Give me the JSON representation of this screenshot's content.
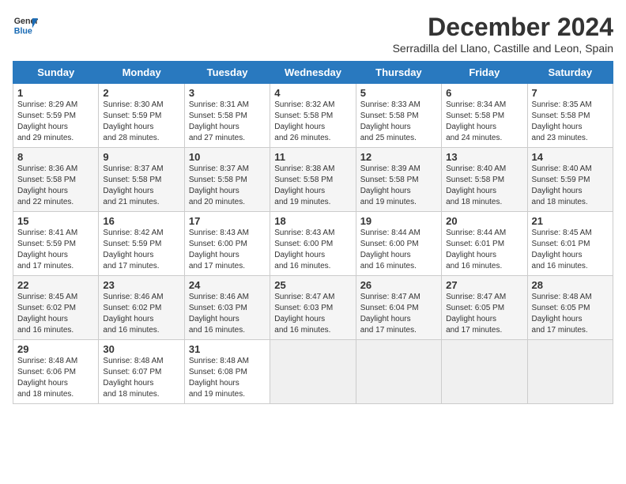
{
  "header": {
    "logo_line1": "General",
    "logo_line2": "Blue",
    "month_title": "December 2024",
    "subtitle": "Serradilla del Llano, Castille and Leon, Spain"
  },
  "weekdays": [
    "Sunday",
    "Monday",
    "Tuesday",
    "Wednesday",
    "Thursday",
    "Friday",
    "Saturday"
  ],
  "weeks": [
    [
      {
        "day": "1",
        "rise": "8:29 AM",
        "set": "5:59 PM",
        "daylight": "9 hours and 29 minutes."
      },
      {
        "day": "2",
        "rise": "8:30 AM",
        "set": "5:59 PM",
        "daylight": "9 hours and 28 minutes."
      },
      {
        "day": "3",
        "rise": "8:31 AM",
        "set": "5:58 PM",
        "daylight": "9 hours and 27 minutes."
      },
      {
        "day": "4",
        "rise": "8:32 AM",
        "set": "5:58 PM",
        "daylight": "9 hours and 26 minutes."
      },
      {
        "day": "5",
        "rise": "8:33 AM",
        "set": "5:58 PM",
        "daylight": "9 hours and 25 minutes."
      },
      {
        "day": "6",
        "rise": "8:34 AM",
        "set": "5:58 PM",
        "daylight": "9 hours and 24 minutes."
      },
      {
        "day": "7",
        "rise": "8:35 AM",
        "set": "5:58 PM",
        "daylight": "9 hours and 23 minutes."
      }
    ],
    [
      {
        "day": "8",
        "rise": "8:36 AM",
        "set": "5:58 PM",
        "daylight": "9 hours and 22 minutes."
      },
      {
        "day": "9",
        "rise": "8:37 AM",
        "set": "5:58 PM",
        "daylight": "9 hours and 21 minutes."
      },
      {
        "day": "10",
        "rise": "8:37 AM",
        "set": "5:58 PM",
        "daylight": "9 hours and 20 minutes."
      },
      {
        "day": "11",
        "rise": "8:38 AM",
        "set": "5:58 PM",
        "daylight": "9 hours and 19 minutes."
      },
      {
        "day": "12",
        "rise": "8:39 AM",
        "set": "5:58 PM",
        "daylight": "9 hours and 19 minutes."
      },
      {
        "day": "13",
        "rise": "8:40 AM",
        "set": "5:58 PM",
        "daylight": "9 hours and 18 minutes."
      },
      {
        "day": "14",
        "rise": "8:40 AM",
        "set": "5:59 PM",
        "daylight": "9 hours and 18 minutes."
      }
    ],
    [
      {
        "day": "15",
        "rise": "8:41 AM",
        "set": "5:59 PM",
        "daylight": "9 hours and 17 minutes."
      },
      {
        "day": "16",
        "rise": "8:42 AM",
        "set": "5:59 PM",
        "daylight": "9 hours and 17 minutes."
      },
      {
        "day": "17",
        "rise": "8:43 AM",
        "set": "6:00 PM",
        "daylight": "9 hours and 17 minutes."
      },
      {
        "day": "18",
        "rise": "8:43 AM",
        "set": "6:00 PM",
        "daylight": "9 hours and 16 minutes."
      },
      {
        "day": "19",
        "rise": "8:44 AM",
        "set": "6:00 PM",
        "daylight": "9 hours and 16 minutes."
      },
      {
        "day": "20",
        "rise": "8:44 AM",
        "set": "6:01 PM",
        "daylight": "9 hours and 16 minutes."
      },
      {
        "day": "21",
        "rise": "8:45 AM",
        "set": "6:01 PM",
        "daylight": "9 hours and 16 minutes."
      }
    ],
    [
      {
        "day": "22",
        "rise": "8:45 AM",
        "set": "6:02 PM",
        "daylight": "9 hours and 16 minutes."
      },
      {
        "day": "23",
        "rise": "8:46 AM",
        "set": "6:02 PM",
        "daylight": "9 hours and 16 minutes."
      },
      {
        "day": "24",
        "rise": "8:46 AM",
        "set": "6:03 PM",
        "daylight": "9 hours and 16 minutes."
      },
      {
        "day": "25",
        "rise": "8:47 AM",
        "set": "6:03 PM",
        "daylight": "9 hours and 16 minutes."
      },
      {
        "day": "26",
        "rise": "8:47 AM",
        "set": "6:04 PM",
        "daylight": "9 hours and 17 minutes."
      },
      {
        "day": "27",
        "rise": "8:47 AM",
        "set": "6:05 PM",
        "daylight": "9 hours and 17 minutes."
      },
      {
        "day": "28",
        "rise": "8:48 AM",
        "set": "6:05 PM",
        "daylight": "9 hours and 17 minutes."
      }
    ],
    [
      {
        "day": "29",
        "rise": "8:48 AM",
        "set": "6:06 PM",
        "daylight": "9 hours and 18 minutes."
      },
      {
        "day": "30",
        "rise": "8:48 AM",
        "set": "6:07 PM",
        "daylight": "9 hours and 18 minutes."
      },
      {
        "day": "31",
        "rise": "8:48 AM",
        "set": "6:08 PM",
        "daylight": "9 hours and 19 minutes."
      },
      null,
      null,
      null,
      null
    ]
  ]
}
